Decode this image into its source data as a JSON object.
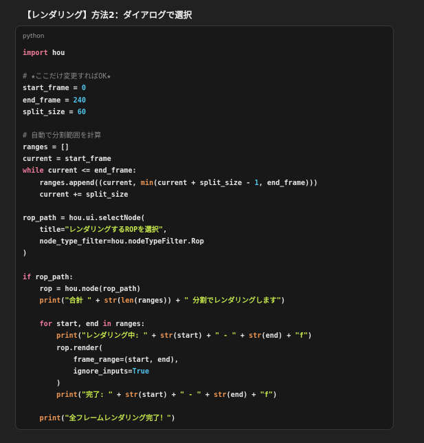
{
  "heading": "【レンダリング】方法2：ダイアログで選択",
  "code_block": {
    "language": "python",
    "lines": [
      [
        {
          "t": "kw",
          "v": "import"
        },
        {
          "t": "p",
          "v": " hou"
        }
      ],
      [],
      [
        {
          "t": "cmt",
          "v": "# ★ここだけ変更すればOK★"
        }
      ],
      [
        {
          "t": "p",
          "v": "start_frame = "
        },
        {
          "t": "num",
          "v": "0"
        }
      ],
      [
        {
          "t": "p",
          "v": "end_frame = "
        },
        {
          "t": "num",
          "v": "240"
        }
      ],
      [
        {
          "t": "p",
          "v": "split_size = "
        },
        {
          "t": "num",
          "v": "60"
        }
      ],
      [],
      [
        {
          "t": "cmt",
          "v": "# 自動で分割範囲を計算"
        }
      ],
      [
        {
          "t": "p",
          "v": "ranges = []"
        }
      ],
      [
        {
          "t": "p",
          "v": "current = start_frame"
        }
      ],
      [
        {
          "t": "kw",
          "v": "while"
        },
        {
          "t": "p",
          "v": " current <= end_frame:"
        }
      ],
      [
        {
          "t": "p",
          "v": "    ranges.append((current, "
        },
        {
          "t": "fn",
          "v": "min"
        },
        {
          "t": "p",
          "v": "(current + split_size - "
        },
        {
          "t": "num",
          "v": "1"
        },
        {
          "t": "p",
          "v": ", end_frame)))"
        }
      ],
      [
        {
          "t": "p",
          "v": "    current += split_size"
        }
      ],
      [],
      [
        {
          "t": "p",
          "v": "rop_path = hou.ui.selectNode("
        }
      ],
      [
        {
          "t": "p",
          "v": "    title="
        },
        {
          "t": "str",
          "v": "\"レンダリングするROPを選択\""
        },
        {
          "t": "p",
          "v": ","
        }
      ],
      [
        {
          "t": "p",
          "v": "    node_type_filter=hou.nodeTypeFilter.Rop"
        }
      ],
      [
        {
          "t": "p",
          "v": ")"
        }
      ],
      [],
      [
        {
          "t": "kw",
          "v": "if"
        },
        {
          "t": "p",
          "v": " rop_path:"
        }
      ],
      [
        {
          "t": "p",
          "v": "    rop = hou.node(rop_path)"
        }
      ],
      [
        {
          "t": "p",
          "v": "    "
        },
        {
          "t": "fn",
          "v": "print"
        },
        {
          "t": "p",
          "v": "("
        },
        {
          "t": "str",
          "v": "\"合計 \""
        },
        {
          "t": "p",
          "v": " + "
        },
        {
          "t": "fn",
          "v": "str"
        },
        {
          "t": "p",
          "v": "("
        },
        {
          "t": "fn",
          "v": "len"
        },
        {
          "t": "p",
          "v": "(ranges)) + "
        },
        {
          "t": "str",
          "v": "\" 分割でレンダリングします\""
        },
        {
          "t": "p",
          "v": ")"
        }
      ],
      [],
      [
        {
          "t": "p",
          "v": "    "
        },
        {
          "t": "kw",
          "v": "for"
        },
        {
          "t": "p",
          "v": " start, end "
        },
        {
          "t": "kw",
          "v": "in"
        },
        {
          "t": "p",
          "v": " ranges:"
        }
      ],
      [
        {
          "t": "p",
          "v": "        "
        },
        {
          "t": "fn",
          "v": "print"
        },
        {
          "t": "p",
          "v": "("
        },
        {
          "t": "str",
          "v": "\"レンダリング中: \""
        },
        {
          "t": "p",
          "v": " + "
        },
        {
          "t": "fn",
          "v": "str"
        },
        {
          "t": "p",
          "v": "(start) + "
        },
        {
          "t": "str",
          "v": "\" - \""
        },
        {
          "t": "p",
          "v": " + "
        },
        {
          "t": "fn",
          "v": "str"
        },
        {
          "t": "p",
          "v": "(end) + "
        },
        {
          "t": "str",
          "v": "\"f\""
        },
        {
          "t": "p",
          "v": ")"
        }
      ],
      [
        {
          "t": "p",
          "v": "        rop.render("
        }
      ],
      [
        {
          "t": "p",
          "v": "            frame_range=(start, end),"
        }
      ],
      [
        {
          "t": "p",
          "v": "            ignore_inputs="
        },
        {
          "t": "bool",
          "v": "True"
        }
      ],
      [
        {
          "t": "p",
          "v": "        )"
        }
      ],
      [
        {
          "t": "p",
          "v": "        "
        },
        {
          "t": "fn",
          "v": "print"
        },
        {
          "t": "p",
          "v": "("
        },
        {
          "t": "str",
          "v": "\"完了: \""
        },
        {
          "t": "p",
          "v": " + "
        },
        {
          "t": "fn",
          "v": "str"
        },
        {
          "t": "p",
          "v": "(start) + "
        },
        {
          "t": "str",
          "v": "\" - \""
        },
        {
          "t": "p",
          "v": " + "
        },
        {
          "t": "fn",
          "v": "str"
        },
        {
          "t": "p",
          "v": "(end) + "
        },
        {
          "t": "str",
          "v": "\"f\""
        },
        {
          "t": "p",
          "v": ")"
        }
      ],
      [],
      [
        {
          "t": "p",
          "v": "    "
        },
        {
          "t": "fn",
          "v": "print"
        },
        {
          "t": "p",
          "v": "("
        },
        {
          "t": "str",
          "v": "\"全フレームレンダリング完了！\""
        },
        {
          "t": "p",
          "v": ")"
        }
      ]
    ]
  },
  "colors": {
    "background": "#212121",
    "code_background": "#181818",
    "keyword": "#ee7a9a",
    "number": "#4fc3ea",
    "string": "#c6e84a",
    "builtin": "#ea9552",
    "comment": "#888888"
  }
}
